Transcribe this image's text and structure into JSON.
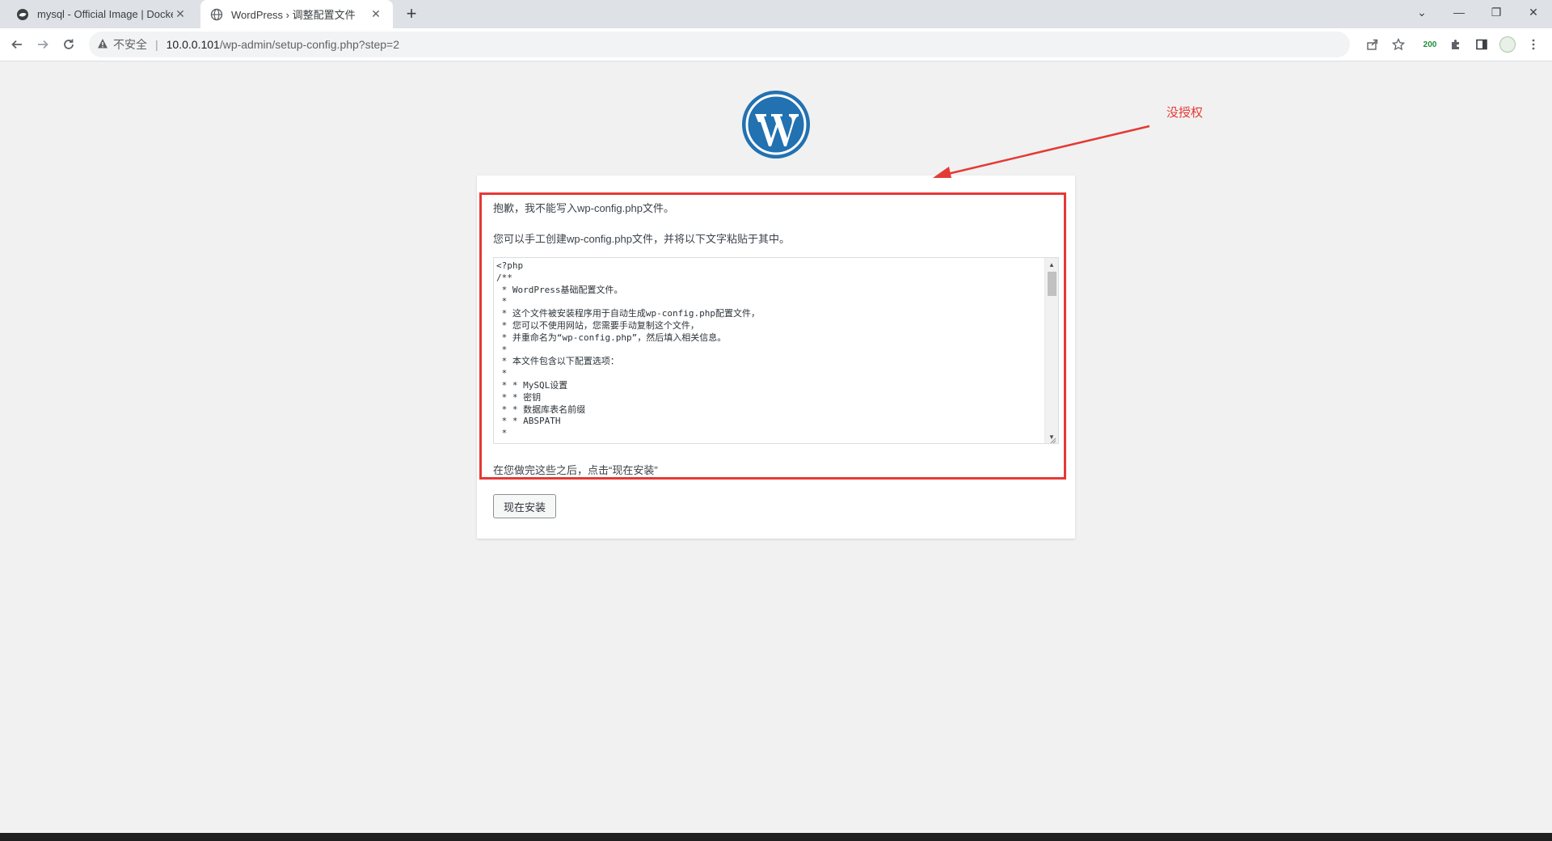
{
  "browser": {
    "tabs": [
      {
        "title": "mysql - Official Image | Docker",
        "close_glyph": "✕"
      },
      {
        "title": "WordPress › 调整配置文件",
        "close_glyph": "✕"
      }
    ],
    "new_tab_glyph": "+",
    "window_controls": [
      "⌄",
      "—",
      "❐",
      "✕"
    ],
    "security_label": "不安全",
    "url_host": "10.0.0.101",
    "url_path": "/wp-admin/setup-config.php?step=2",
    "extension_badge": "200",
    "icons": [
      "back-icon",
      "forward-icon",
      "reload-icon",
      "warning-icon",
      "share-icon",
      "star-icon",
      "puzzle-icon",
      "sidebar-icon",
      "menu-icon"
    ]
  },
  "page": {
    "error_message": "抱歉，我不能写入wp-config.php文件。",
    "instruction": "您可以手工创建wp-config.php文件，并将以下文字粘贴于其中。",
    "config_code": "<?php\n/**\n * WordPress基础配置文件。\n *\n * 这个文件被安装程序用于自动生成wp-config.php配置文件，\n * 您可以不使用网站，您需要手动复制这个文件，\n * 并重命名为“wp-config.php”，然后填入相关信息。\n *\n * 本文件包含以下配置选项：\n *\n * * MySQL设置\n * * 密钥\n * * 数据库表名前缀\n * * ABSPATH\n *",
    "after_text": "在您做完这些之后，点击“现在安装”",
    "install_button": "现在安装"
  },
  "annotation": {
    "label": "没授权",
    "color": "#e53935"
  }
}
